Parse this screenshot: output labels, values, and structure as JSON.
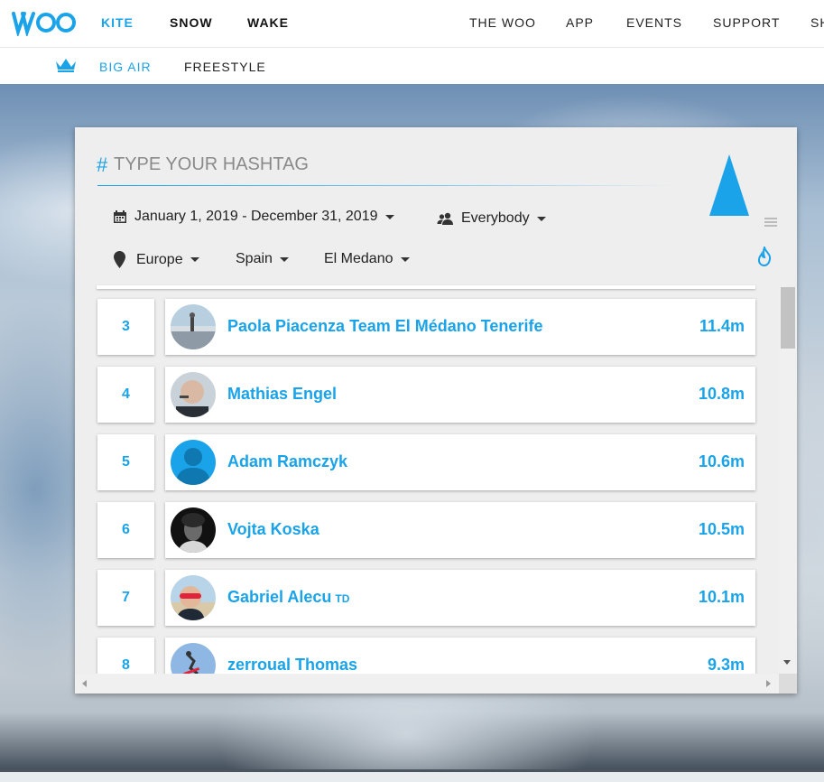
{
  "colors": {
    "accent": "#1aa3e8",
    "text": "#222222",
    "panel": "#eeeeee"
  },
  "nav": {
    "logo": "WOO",
    "left": [
      "KITE",
      "SNOW",
      "WAKE"
    ],
    "right": [
      "THE WOO",
      "APP",
      "EVENTS",
      "SUPPORT",
      "SH"
    ],
    "active": "KITE"
  },
  "subnav": {
    "icon": "crown-icon",
    "items": [
      "BIG AIR",
      "FREESTYLE"
    ],
    "active": "BIG AIR"
  },
  "search": {
    "hash": "#",
    "placeholder": "TYPE YOUR HASHTAG"
  },
  "filters": {
    "date_range": "January 1, 2019 - December 31, 2019",
    "audience": "Everybody",
    "region": "Europe",
    "country": "Spain",
    "spot": "El Medano"
  },
  "leaderboard": [
    {
      "rank": "3",
      "name": "Paola Piacenza Team El Médano Tenerife",
      "badge": "",
      "height": "11.4m",
      "avatar": "beach"
    },
    {
      "rank": "4",
      "name": "Mathias Engel",
      "badge": "",
      "height": "10.8m",
      "avatar": "photo-light"
    },
    {
      "rank": "5",
      "name": "Adam Ramczyk",
      "badge": "",
      "height": "10.6m",
      "avatar": "default-silhouette"
    },
    {
      "rank": "6",
      "name": "Vojta Koska",
      "badge": "",
      "height": "10.5m",
      "avatar": "photo-dark"
    },
    {
      "rank": "7",
      "name": "Gabriel Alecu",
      "badge": "TD",
      "height": "10.1m",
      "avatar": "photo-sunglasses"
    },
    {
      "rank": "8",
      "name": "zerroual Thomas",
      "badge": "",
      "height": "9.3m",
      "avatar": "kite-sky"
    }
  ]
}
